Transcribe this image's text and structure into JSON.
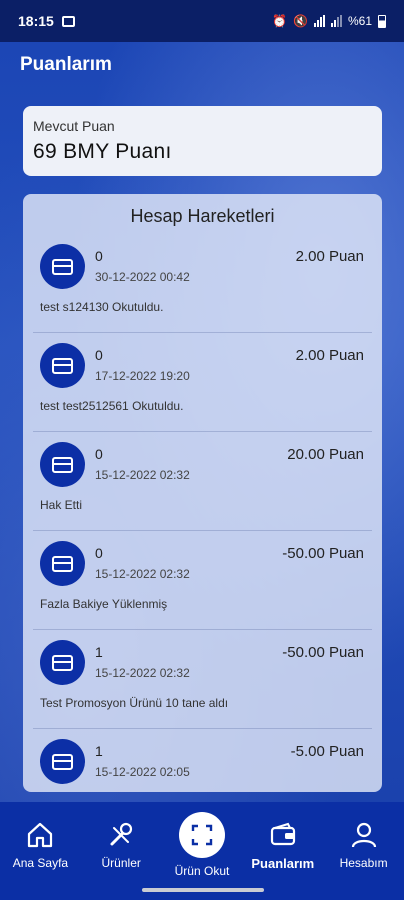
{
  "status": {
    "time": "18:15",
    "battery": "%61"
  },
  "header": {
    "title": "Puanlarım"
  },
  "points": {
    "label": "Mevcut Puan",
    "value": "69 BMY Puanı"
  },
  "transactions": {
    "title": "Hesap Hareketleri",
    "items": [
      {
        "code": "0",
        "date": "30-12-2022 00:42",
        "amount": "2.00 Puan",
        "desc": "test s124130 Okutuldu."
      },
      {
        "code": "0",
        "date": "17-12-2022 19:20",
        "amount": "2.00 Puan",
        "desc": "test test2512561 Okutuldu."
      },
      {
        "code": "0",
        "date": "15-12-2022 02:32",
        "amount": "20.00 Puan",
        "desc": "Hak Etti"
      },
      {
        "code": "0",
        "date": "15-12-2022 02:32",
        "amount": "-50.00 Puan",
        "desc": "Fazla Bakiye Yüklenmiş"
      },
      {
        "code": "1",
        "date": "15-12-2022 02:32",
        "amount": "-50.00 Puan",
        "desc": "Test Promosyon Ürünü 10 tane aldı"
      },
      {
        "code": "1",
        "date": "15-12-2022 02:05",
        "amount": "-5.00 Puan",
        "desc": ""
      }
    ]
  },
  "nav": {
    "items": [
      {
        "label": "Ana Sayfa",
        "icon": "home-icon"
      },
      {
        "label": "Ürünler",
        "icon": "tools-icon"
      },
      {
        "label": "Ürün Okut",
        "icon": "scan-icon"
      },
      {
        "label": "Puanlarım",
        "icon": "wallet-icon"
      },
      {
        "label": "Hesabım",
        "icon": "user-icon"
      }
    ]
  }
}
